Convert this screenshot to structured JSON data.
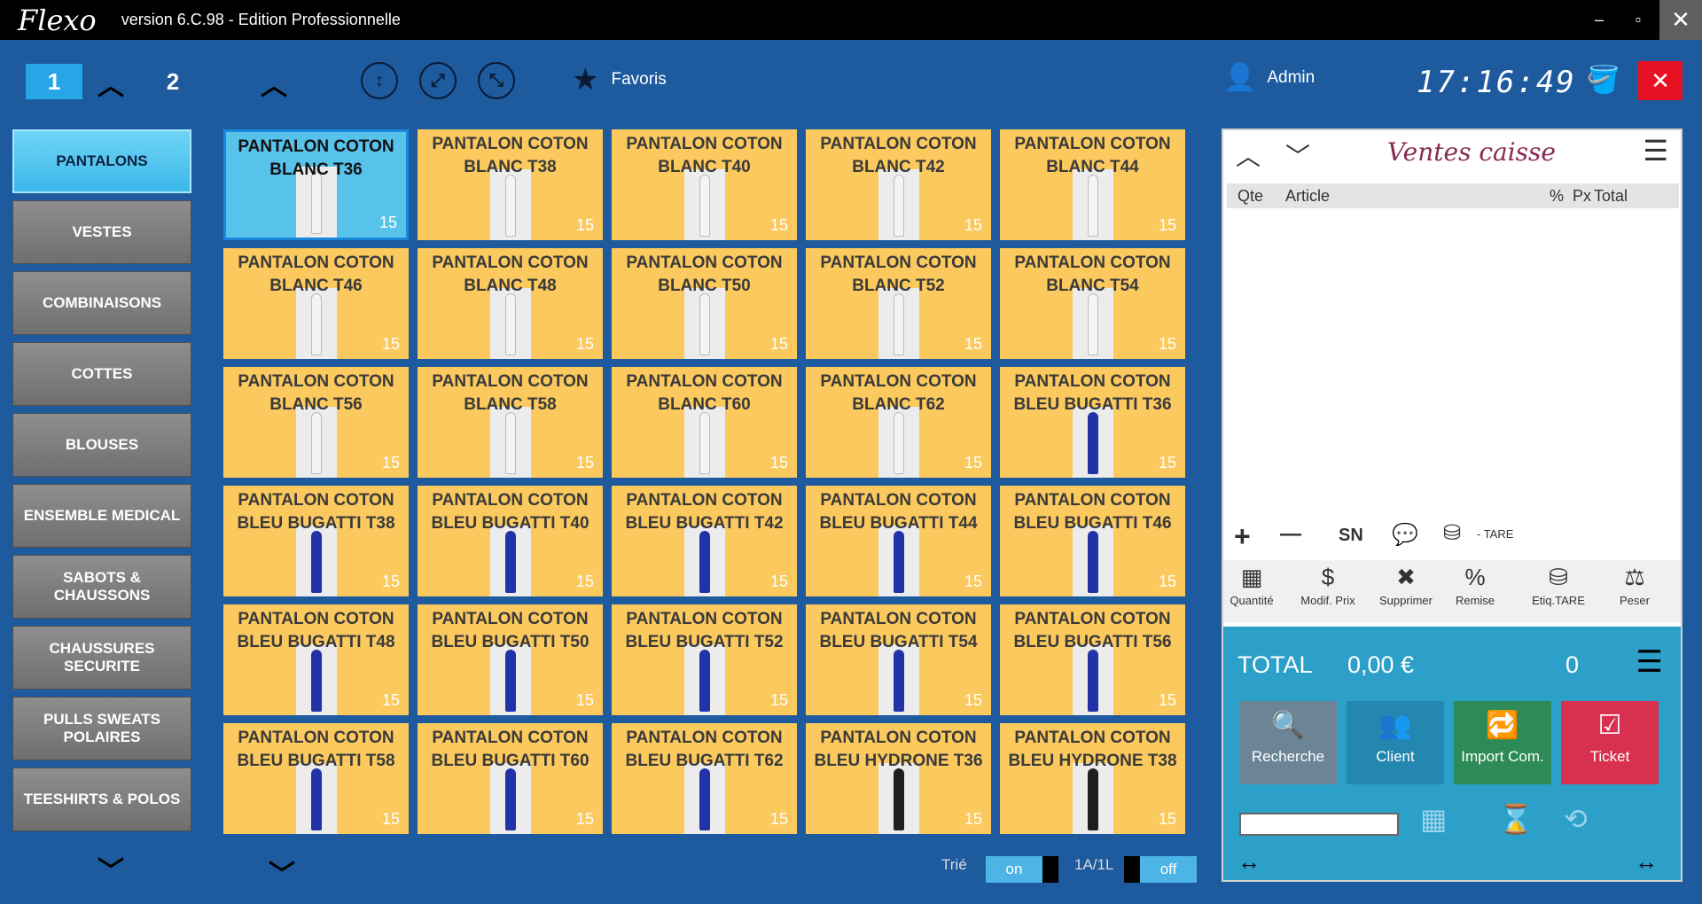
{
  "titlebar": {
    "app_name": "Flexo",
    "version": "version 6.C.98 - Edition Professionnelle",
    "minimize": "–",
    "maximize": "▫",
    "close": "✕"
  },
  "topbar": {
    "page1": "1",
    "page2": "2",
    "favorites": "Favoris",
    "user": "Admin",
    "clock": "17:16:49"
  },
  "categories": [
    "PANTALONS",
    "VESTES",
    "COMBINAISONS",
    "COTTES",
    "BLOUSES",
    "ENSEMBLE MEDICAL",
    "SABOTS & CHAUSSONS",
    "CHAUSSURES SECURITE",
    "PULLS SWEATS POLAIRES",
    "TEESHIRTS & POLOS"
  ],
  "products": [
    {
      "name": "PANTALON COTON BLANC T36",
      "qty": "15",
      "color": "white"
    },
    {
      "name": "PANTALON COTON BLANC T38",
      "qty": "15",
      "color": "white"
    },
    {
      "name": "PANTALON COTON BLANC T40",
      "qty": "15",
      "color": "white"
    },
    {
      "name": "PANTALON COTON BLANC T42",
      "qty": "15",
      "color": "white"
    },
    {
      "name": "PANTALON COTON BLANC T44",
      "qty": "15",
      "color": "white"
    },
    {
      "name": "PANTALON COTON BLANC T46",
      "qty": "15",
      "color": "white"
    },
    {
      "name": "PANTALON COTON BLANC T48",
      "qty": "15",
      "color": "white"
    },
    {
      "name": "PANTALON COTON BLANC T50",
      "qty": "15",
      "color": "white"
    },
    {
      "name": "PANTALON COTON BLANC T52",
      "qty": "15",
      "color": "white"
    },
    {
      "name": "PANTALON COTON BLANC T54",
      "qty": "15",
      "color": "white"
    },
    {
      "name": "PANTALON COTON BLANC T56",
      "qty": "15",
      "color": "white"
    },
    {
      "name": "PANTALON COTON BLANC T58",
      "qty": "15",
      "color": "white"
    },
    {
      "name": "PANTALON COTON BLANC T60",
      "qty": "15",
      "color": "white"
    },
    {
      "name": "PANTALON COTON BLANC T62",
      "qty": "15",
      "color": "white"
    },
    {
      "name": "PANTALON COTON BLEU BUGATTI T36",
      "qty": "15",
      "color": "blue"
    },
    {
      "name": "PANTALON COTON BLEU BUGATTI T38",
      "qty": "15",
      "color": "blue"
    },
    {
      "name": "PANTALON COTON BLEU BUGATTI T40",
      "qty": "15",
      "color": "blue"
    },
    {
      "name": "PANTALON COTON BLEU BUGATTI T42",
      "qty": "15",
      "color": "blue"
    },
    {
      "name": "PANTALON COTON BLEU BUGATTI T44",
      "qty": "15",
      "color": "blue"
    },
    {
      "name": "PANTALON COTON BLEU BUGATTI T46",
      "qty": "15",
      "color": "blue"
    },
    {
      "name": "PANTALON COTON BLEU BUGATTI T48",
      "qty": "15",
      "color": "blue"
    },
    {
      "name": "PANTALON COTON BLEU BUGATTI T50",
      "qty": "15",
      "color": "blue"
    },
    {
      "name": "PANTALON COTON BLEU BUGATTI T52",
      "qty": "15",
      "color": "blue"
    },
    {
      "name": "PANTALON COTON BLEU BUGATTI T54",
      "qty": "15",
      "color": "blue"
    },
    {
      "name": "PANTALON COTON BLEU BUGATTI T56",
      "qty": "15",
      "color": "blue"
    },
    {
      "name": "PANTALON COTON BLEU BUGATTI T58",
      "qty": "15",
      "color": "blue"
    },
    {
      "name": "PANTALON COTON BLEU BUGATTI T60",
      "qty": "15",
      "color": "blue"
    },
    {
      "name": "PANTALON COTON BLEU BUGATTI T62",
      "qty": "15",
      "color": "blue"
    },
    {
      "name": "PANTALON COTON BLEU HYDRONE T36",
      "qty": "15",
      "color": "black"
    },
    {
      "name": "PANTALON COTON BLEU HYDRONE T38",
      "qty": "15",
      "color": "black"
    }
  ],
  "bottombar": {
    "sort_label": "Trié",
    "sort_value": "on",
    "layout_label": "1A/1L",
    "layout_value": "off"
  },
  "panel": {
    "title": "Ventes caisse",
    "columns": {
      "qty": "Qte",
      "article": "Article",
      "percent": "%",
      "price": "Px",
      "total": "Total"
    },
    "tools_row1": {
      "plus": "+",
      "minus": "—",
      "sn": "SN",
      "tare": "- TARE"
    },
    "tools_row2": [
      "Quantité",
      "Modif. Prix",
      "Supprimer",
      "Remise",
      "Etiq.TARE",
      "Peser"
    ],
    "total_label": "TOTAL",
    "total_value": "0,00 €",
    "total_count": "0",
    "buttons": {
      "search": "Recherche",
      "client": "Client",
      "import": "Import Com.",
      "ticket": "Ticket"
    }
  },
  "colors": {
    "background": "#1d5a9e",
    "tile": "#fbc95e",
    "tile_selected": "#57c2ea",
    "accent": "#2ca0c8",
    "ticket": "#d8304f",
    "import": "#2e8b57",
    "search": "#6b8596",
    "client": "#2487b0"
  }
}
